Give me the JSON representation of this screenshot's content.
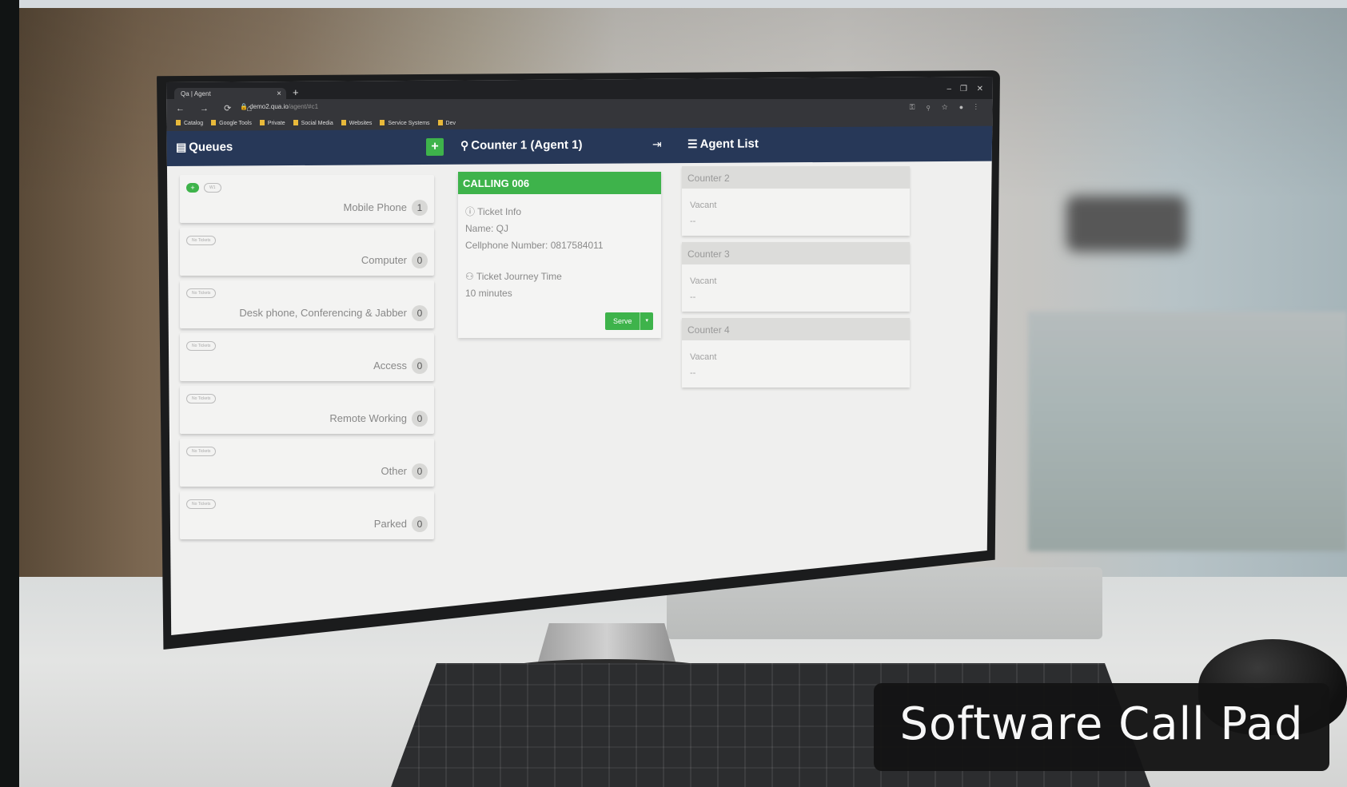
{
  "browser": {
    "tab_title": "Qa | Agent",
    "tab_close": "×",
    "new_tab": "+",
    "window_controls": [
      "–",
      "❐",
      "✕"
    ],
    "url_host": "demo2.qua.io",
    "url_path": "/agent/#c1",
    "bookmarks": [
      "Catalog",
      "Google Tools",
      "Private",
      "Social Media",
      "Websites",
      "Service Systems",
      "Dev"
    ]
  },
  "nav": {
    "queues_title": "Queues",
    "queues_add": "+",
    "counter_title": "Counter 1 (Agent 1)",
    "agent_list_title": "Agent List"
  },
  "queues": [
    {
      "name": "Mobile Phone",
      "count": "1",
      "pill": "W1",
      "active": true
    },
    {
      "name": "Computer",
      "count": "0",
      "pill": "No Tickets"
    },
    {
      "name": "Desk phone, Conferencing & Jabber",
      "count": "0",
      "pill": "No Tickets"
    },
    {
      "name": "Access",
      "count": "0",
      "pill": "No Tickets"
    },
    {
      "name": "Remote Working",
      "count": "0",
      "pill": "No Tickets"
    },
    {
      "name": "Other",
      "count": "0",
      "pill": "No Tickets"
    },
    {
      "name": "Parked",
      "count": "0",
      "pill": "No Tickets"
    }
  ],
  "calling": {
    "header": "CALLING 006",
    "ticket_info_label": "Ticket Info",
    "name_line": "Name: QJ",
    "cellphone_line": "Cellphone Number: 0817584011",
    "journey_label": "Ticket Journey Time",
    "journey_value": "10 minutes",
    "serve_label": "Serve",
    "serve_caret": "▾"
  },
  "agents": [
    {
      "counter": "Counter 2",
      "status": "Vacant",
      "detail": "--"
    },
    {
      "counter": "Counter 3",
      "status": "Vacant",
      "detail": "--"
    },
    {
      "counter": "Counter 4",
      "status": "Vacant",
      "detail": "--"
    }
  ],
  "caption": "Software Call Pad",
  "colors": {
    "navbar": "#273858",
    "accent_green": "#3eb34b"
  }
}
